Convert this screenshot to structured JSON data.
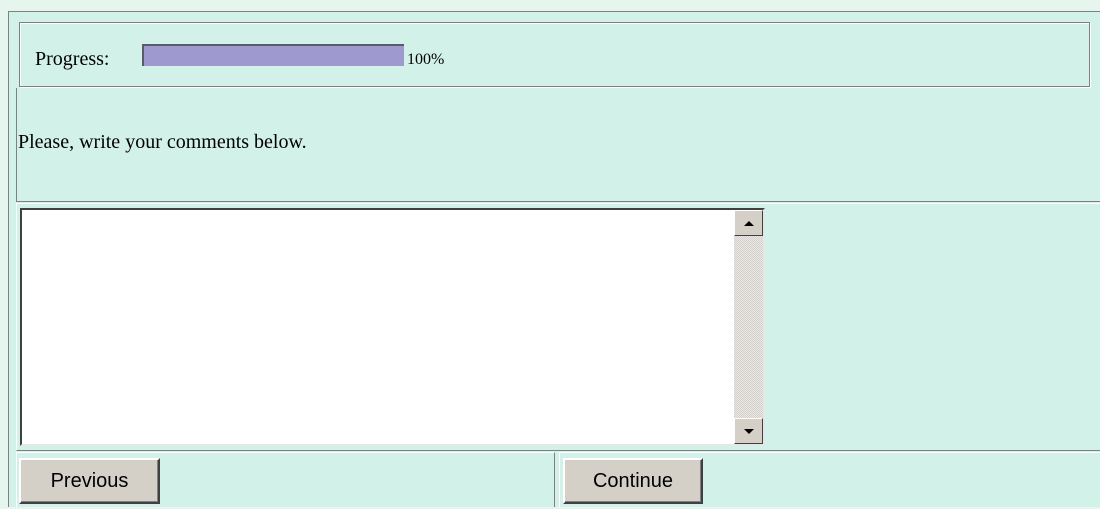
{
  "progress": {
    "label": "Progress:",
    "value_text": "100%",
    "fraction": 1.0,
    "fill_color": "#9e99cf"
  },
  "instruction": {
    "text": "Please, write your comments below."
  },
  "comments": {
    "value": "",
    "scroll_up_icon": "scroll-up-arrow",
    "scroll_down_icon": "scroll-down-arrow"
  },
  "buttons": {
    "previous_label": "Previous",
    "continue_label": "Continue"
  },
  "colors": {
    "page_background": "#d2f1e8",
    "button_face": "#d4d0c8"
  }
}
